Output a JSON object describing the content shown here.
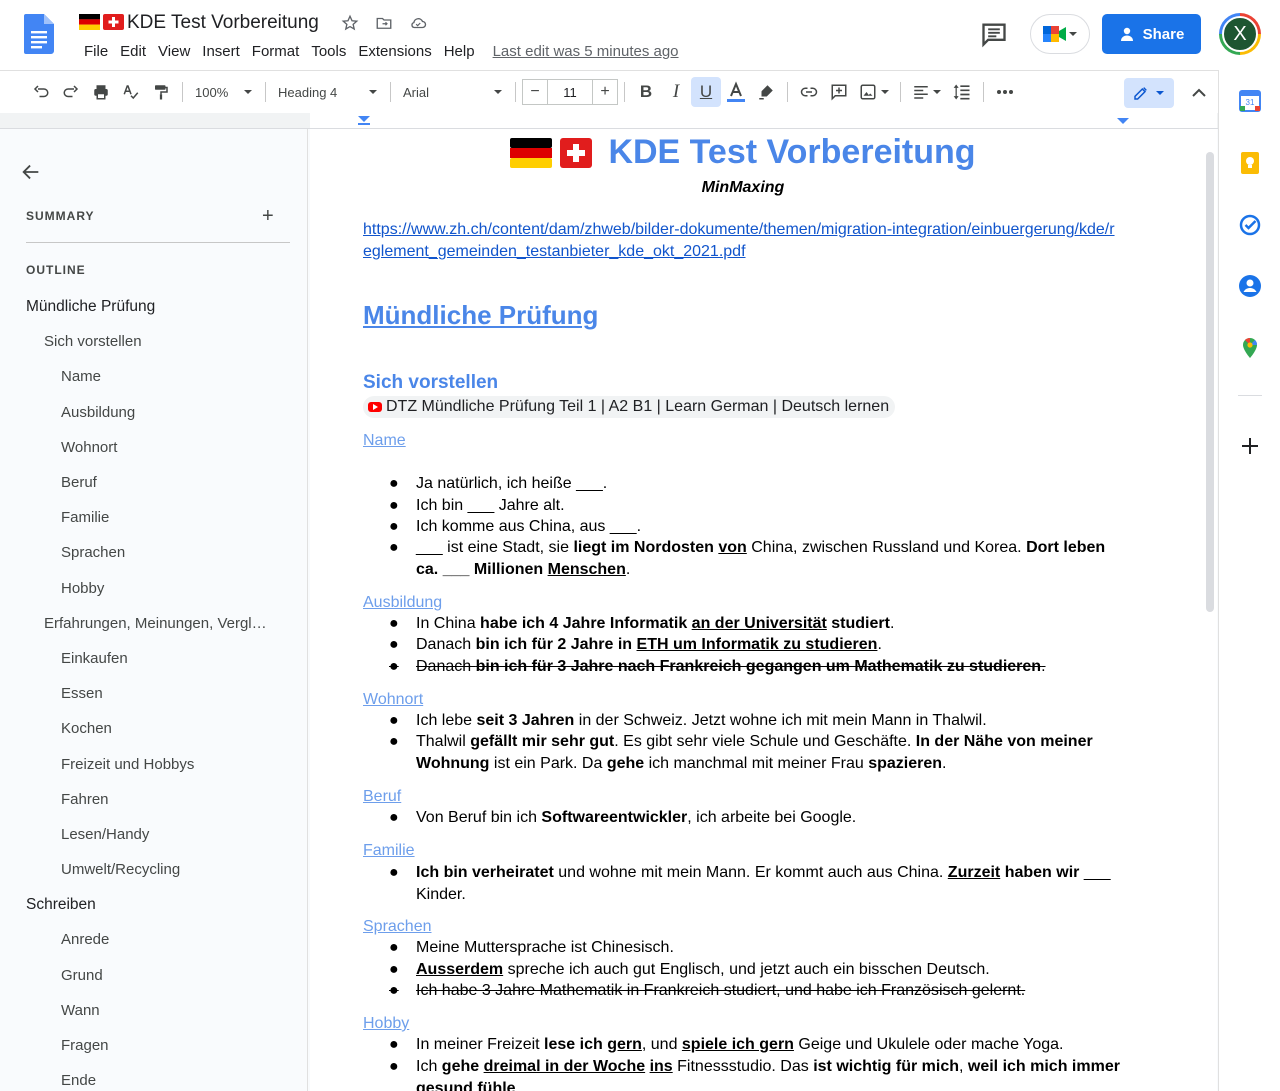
{
  "app": {
    "doc_title": "KDE Test Vorbereitung",
    "menu": [
      "File",
      "Edit",
      "View",
      "Insert",
      "Format",
      "Tools",
      "Extensions",
      "Help"
    ],
    "last_edit": "Last edit was 5 minutes ago",
    "share_label": "Share",
    "avatar_letter": "X"
  },
  "toolbar": {
    "zoom": "100%",
    "style": "Heading 4",
    "font": "Arial",
    "font_size": "11"
  },
  "outline": {
    "summary_label": "SUMMARY",
    "outline_label": "OUTLINE",
    "items": [
      {
        "level": 1,
        "label": "Mündliche Prüfung"
      },
      {
        "level": 2,
        "label": "Sich vorstellen"
      },
      {
        "level": 3,
        "label": "Name"
      },
      {
        "level": 3,
        "label": "Ausbildung"
      },
      {
        "level": 3,
        "label": "Wohnort"
      },
      {
        "level": 3,
        "label": "Beruf"
      },
      {
        "level": 3,
        "label": "Familie"
      },
      {
        "level": 3,
        "label": "Sprachen"
      },
      {
        "level": 3,
        "label": "Hobby"
      },
      {
        "level": 2,
        "label": "Erfahrungen, Meinungen, Vergl…"
      },
      {
        "level": 3,
        "label": "Einkaufen"
      },
      {
        "level": 3,
        "label": "Essen"
      },
      {
        "level": 3,
        "label": "Kochen"
      },
      {
        "level": 3,
        "label": "Freizeit und Hobbys"
      },
      {
        "level": 3,
        "label": "Fahren"
      },
      {
        "level": 3,
        "label": "Lesen/Handy"
      },
      {
        "level": 3,
        "label": "Umwelt/Recycling"
      },
      {
        "level": 1,
        "label": "Schreiben"
      },
      {
        "level": 3,
        "label": "Anrede"
      },
      {
        "level": 3,
        "label": "Grund"
      },
      {
        "level": 3,
        "label": "Wann"
      },
      {
        "level": 3,
        "label": "Fragen"
      },
      {
        "level": 3,
        "label": "Ende"
      }
    ]
  },
  "document": {
    "title": "KDE Test Vorbereitung",
    "subtitle": "MinMaxing",
    "link": "https://www.zh.ch/content/dam/zhweb/bilder-dokumente/themen/migration-integration/einbuergerung/kde/reglement_gemeinden_testanbieter_kde_okt_2021.pdf",
    "h1": "Mündliche Prüfung",
    "h2": "Sich vorstellen",
    "chip": "DTZ  Mündliche Prüfung Teil 1 | A2 B1 | Learn German | Deutsch lernen",
    "sections": {
      "name": "Name",
      "ausbildung": "Ausbildung",
      "wohnort": "Wohnort",
      "beruf": "Beruf",
      "familie": "Familie",
      "sprachen": "Sprachen",
      "hobby": "Hobby"
    },
    "bullets": {
      "name_1": "Ja natürlich, ich heiße ___.",
      "name_2": "Ich bin ___ Jahre alt.",
      "name_3": "Ich komme aus China, aus ___.",
      "name_4_a": "___ ist eine Stadt, sie ",
      "name_4_b": "liegt im Nordosten ",
      "name_4_c": "von",
      "name_4_d": " China, zwischen Russland und Korea. ",
      "name_4_e": "Dort leben ca. ___ Millionen ",
      "name_4_f": "Menschen",
      "ausb_1_a": "In China ",
      "ausb_1_b": "habe ich 4 Jahre Informatik ",
      "ausb_1_c": "an der Universität",
      "ausb_1_d": " studiert",
      "ausb_2_a": "Danach ",
      "ausb_2_b": "bin ich für 2 Jahre in ",
      "ausb_2_c": "ETH um Informatik zu studieren",
      "ausb_3_a": "Danach ",
      "ausb_3_b": "bin ich für 3 Jahre nach Frankreich gegangen um Mathematik zu studieren",
      "wohn_1_a": "Ich lebe ",
      "wohn_1_b": "seit 3 Jahren",
      "wohn_1_c": " in der Schweiz. Jetzt wohne ich mit mein Mann in Thalwil.",
      "wohn_2_a": "Thalwil ",
      "wohn_2_b": "gefällt mir sehr gut",
      "wohn_2_c": ". Es gibt sehr viele Schule und Geschäfte. ",
      "wohn_2_d": "In der Nähe von meiner Wohnung",
      "wohn_2_e": " ist ein Park. Da ",
      "wohn_2_f": "gehe",
      "wohn_2_g": " ich manchmal mit meiner Frau ",
      "wohn_2_h": "spazieren",
      "beruf_1_a": "Von Beruf bin ich ",
      "beruf_1_b": "Softwareentwickler",
      "beruf_1_c": ", ich arbeite bei Google.",
      "fam_1_a": "Ich bin verheiratet",
      "fam_1_b": " und wohne mit mein Mann. Er kommt auch aus China. ",
      "fam_1_c": "Zurzeit",
      "fam_1_d": " haben wir ",
      "fam_1_e": "___",
      "fam_1_f": " Kinder.",
      "spr_1": "Meine Muttersprache ist Chinesisch.",
      "spr_2_a": "Ausserdem",
      "spr_2_b": " spreche ich auch gut Englisch, und jetzt auch ein bisschen Deutsch.",
      "spr_3": "Ich habe 3 Jahre Mathematik in Frankreich studiert, und habe ich Französisch gelernt.",
      "hob_1_a": "In meiner Freizeit ",
      "hob_1_b": "lese ich ",
      "hob_1_c": "gern",
      "hob_1_d": ", und ",
      "hob_1_e": "spiele ich gern",
      "hob_1_f": " Geige und Ukulele oder mache Yoga.",
      "hob_2_a": "Ich ",
      "hob_2_b": "gehe ",
      "hob_2_c": "dreimal in der Woche",
      "hob_2_d": " ",
      "hob_2_e": "ins",
      "hob_2_f": " Fitnessstudio. Das ",
      "hob_2_g": "ist wichtig für mich",
      "hob_2_h": ", ",
      "hob_2_i": "weil ich mich immer gesund fühle",
      "hob_2_j": "."
    }
  },
  "colors": {
    "accent": "#1a73e8",
    "heading": "#4a86e8",
    "heading4": "#6d9eeb",
    "link": "#1155cc"
  }
}
